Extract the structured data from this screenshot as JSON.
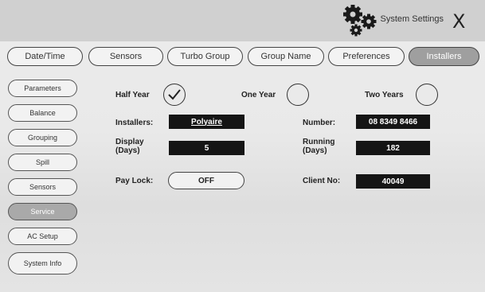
{
  "header": {
    "title": "System Settings",
    "close_label": "X",
    "icon": "gears-icon"
  },
  "tabs": [
    {
      "label": "Date/Time",
      "active": false
    },
    {
      "label": "Sensors",
      "active": false
    },
    {
      "label": "Turbo Group",
      "active": false
    },
    {
      "label": "Group Name",
      "active": false
    },
    {
      "label": "Preferences",
      "active": false
    },
    {
      "label": "Installers",
      "active": true
    }
  ],
  "sidebar": {
    "items": [
      {
        "label": "Parameters",
        "active": false
      },
      {
        "label": "Balance",
        "active": false
      },
      {
        "label": "Grouping",
        "active": false
      },
      {
        "label": "Spill",
        "active": false
      },
      {
        "label": "Sensors",
        "active": false
      },
      {
        "label": "Service",
        "active": true
      },
      {
        "label": "AC Setup",
        "active": false
      },
      {
        "label": "System Info",
        "active": false
      }
    ]
  },
  "service": {
    "options": [
      {
        "label": "Half Year",
        "checked": true
      },
      {
        "label": "One Year",
        "checked": false
      },
      {
        "label": "Two Years",
        "checked": false
      }
    ],
    "installers_label": "Installers:",
    "installers_value": "Polyaire",
    "number_label": "Number:",
    "number_value": "08 8349 8466",
    "display_label_line1": "Display",
    "display_label_line2": "(Days)",
    "display_value": "5",
    "running_label_line1": "Running",
    "running_label_line2": "(Days)",
    "running_value": "182",
    "paylock_label": "Pay Lock:",
    "paylock_value": "OFF",
    "client_label": "Client No:",
    "client_value": "40049"
  },
  "colors": {
    "active_tab": "#9f9f9f",
    "value_box": "#151515",
    "header_bg": "#d0d0d0"
  }
}
